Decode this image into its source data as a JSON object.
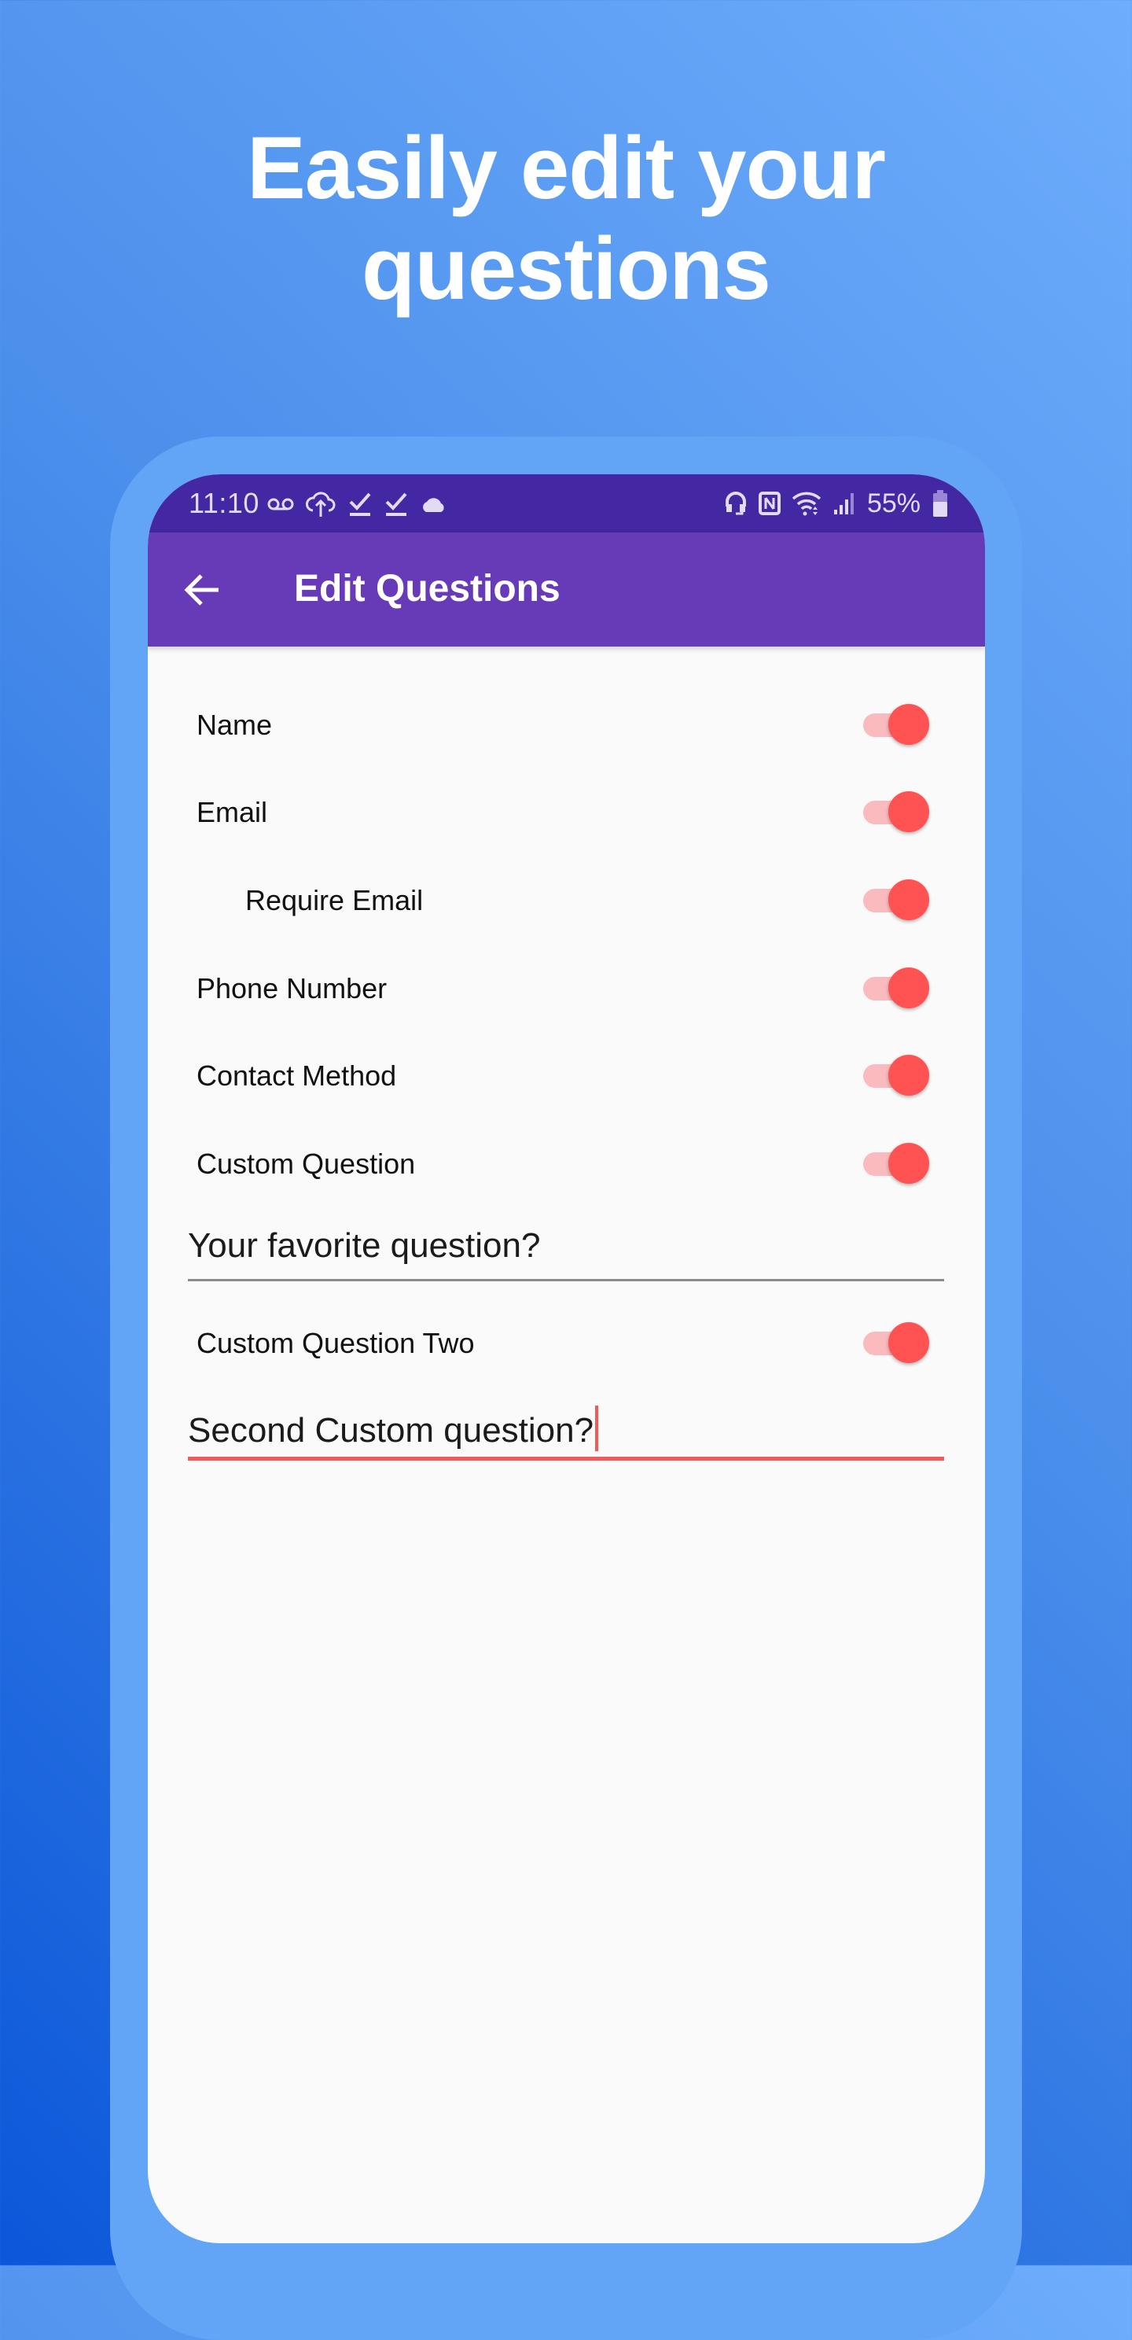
{
  "headline": {
    "line1": "Easily edit your",
    "line2": "questions"
  },
  "colors": {
    "background_top_right": "#6EADFC",
    "background_bottom_left": "#0B57D9",
    "frame": "#62A4F5",
    "status_bar": "#4327A3",
    "app_bar": "#673AB7",
    "accent": "#FF5252",
    "toggle_track": "#F9BBBE"
  },
  "status_bar": {
    "time": "11:10",
    "left_icons": [
      "voicemail-icon",
      "cloud-upload-icon",
      "download-done-icon",
      "download-done-icon",
      "cloud-icon"
    ],
    "right_icons": [
      "headset-icon",
      "nfc-icon",
      "wifi-icon",
      "signal-icon"
    ],
    "battery_percent": "55%",
    "battery_icon": "battery-icon"
  },
  "app_bar": {
    "back_icon": "arrow-back-icon",
    "title": "Edit Questions"
  },
  "questions": [
    {
      "label": "Name",
      "enabled": true,
      "indent": false
    },
    {
      "label": "Email",
      "enabled": true,
      "indent": false
    },
    {
      "label": "Require Email",
      "enabled": true,
      "indent": true
    },
    {
      "label": "Phone Number",
      "enabled": true,
      "indent": false
    },
    {
      "label": "Contact Method",
      "enabled": true,
      "indent": false
    },
    {
      "label": "Custom Question",
      "enabled": true,
      "indent": false
    }
  ],
  "custom_question_field": {
    "value": "Your favorite question?",
    "focused": false
  },
  "custom_question_two": {
    "label": "Custom Question Two",
    "enabled": true
  },
  "custom_question_two_field": {
    "value": "Second Custom question?",
    "focused": true
  }
}
